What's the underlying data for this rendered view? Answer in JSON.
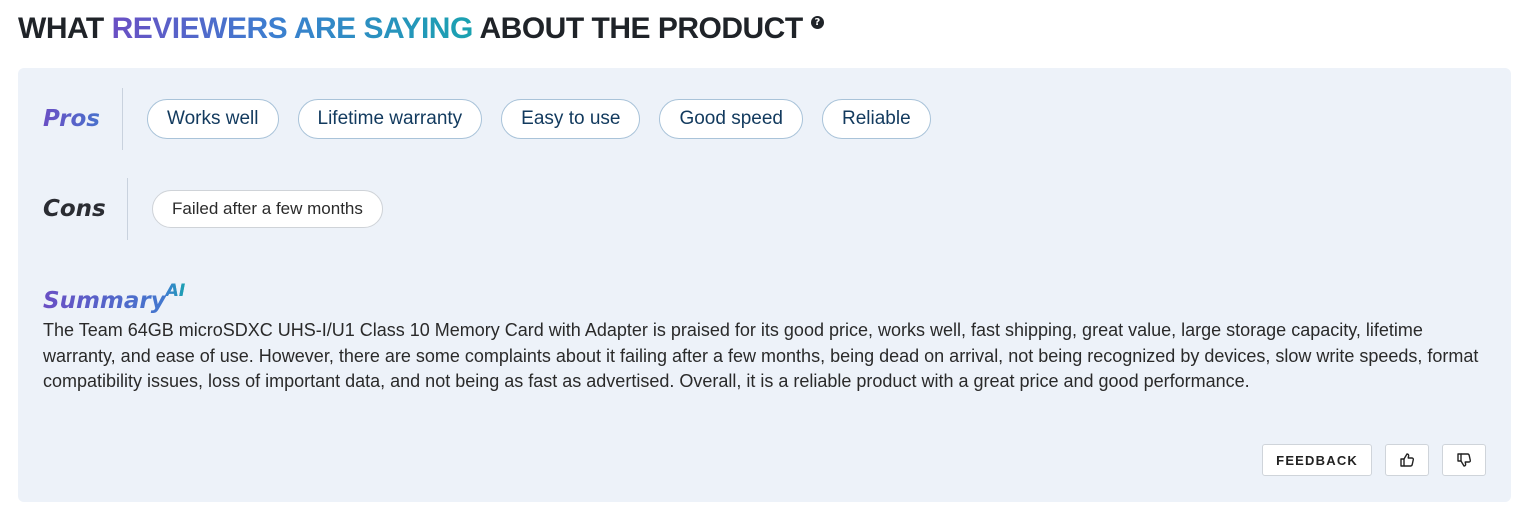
{
  "heading": {
    "part1": "WHAT ",
    "highlight": "REVIEWERS ARE SAYING",
    "part2": " ABOUT THE PRODUCT",
    "help_icon": "question-circle-icon",
    "help_glyph": "?"
  },
  "pros": {
    "label": "Pros",
    "chips": [
      "Works well",
      "Lifetime warranty",
      "Easy to use",
      "Good speed",
      "Reliable"
    ]
  },
  "cons": {
    "label": "Cons",
    "chips": [
      "Failed after a few months"
    ]
  },
  "summary": {
    "title": "Summary",
    "badge": "AI",
    "text": "The Team 64GB microSDXC UHS-I/U1 Class 10 Memory Card with Adapter is praised for its good price, works well, fast shipping, great value, large storage capacity, lifetime warranty, and ease of use. However, there are some complaints about it failing after a few months, being dead on arrival, not being recognized by devices, slow write speeds, format compatibility issues, loss of important data, and not being as fast as advertised. Overall, it is a reliable product with a great price and good performance."
  },
  "actions": {
    "feedback_label": "FEEDBACK",
    "thumbs_up_icon": "thumbs-up-icon",
    "thumbs_down_icon": "thumbs-down-icon"
  },
  "colors": {
    "panel_bg": "#edf2f9",
    "accent_purple": "#6a4fc4",
    "accent_blue": "#3c7fd0",
    "accent_teal": "#1aa2b0",
    "chip_border": "#a9c3d9"
  }
}
